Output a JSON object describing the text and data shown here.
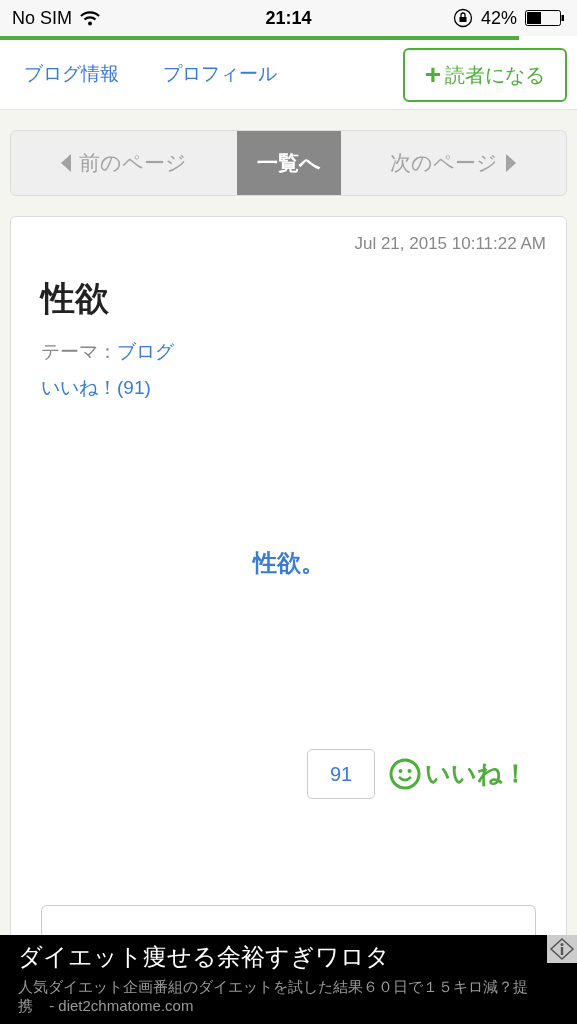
{
  "status_bar": {
    "carrier": "No SIM",
    "time": "21:14",
    "battery": "42%"
  },
  "loading": {
    "level": 0.9
  },
  "nav": {
    "links": [
      "ブログ情報",
      "プロフィール"
    ],
    "follow_button": "読者になる",
    "follow_icon": "+"
  },
  "pager": [
    {
      "kind": "prev",
      "label": "前のページ",
      "disabled": true
    },
    {
      "kind": "list",
      "label": "一覧へ",
      "disabled": false
    },
    {
      "kind": "next",
      "label": "次のページ",
      "disabled": true
    }
  ],
  "entry": {
    "date": "Jul 21, 2015 10:11:22 AM",
    "title": "性欲",
    "theme_label": "テーマ：",
    "theme": "ブログ",
    "likes_link": "いいね！(91)",
    "body": "性欲。",
    "like_count": "91",
    "like_button": "いいね！"
  },
  "ad": {
    "headline": "ダイエット痩せる余裕すぎワロタ",
    "text": "人気ダイエット企画番組のダイエットを試した結果６０日で１５キロ減？提携",
    "source": "- diet2chmatome.com"
  }
}
